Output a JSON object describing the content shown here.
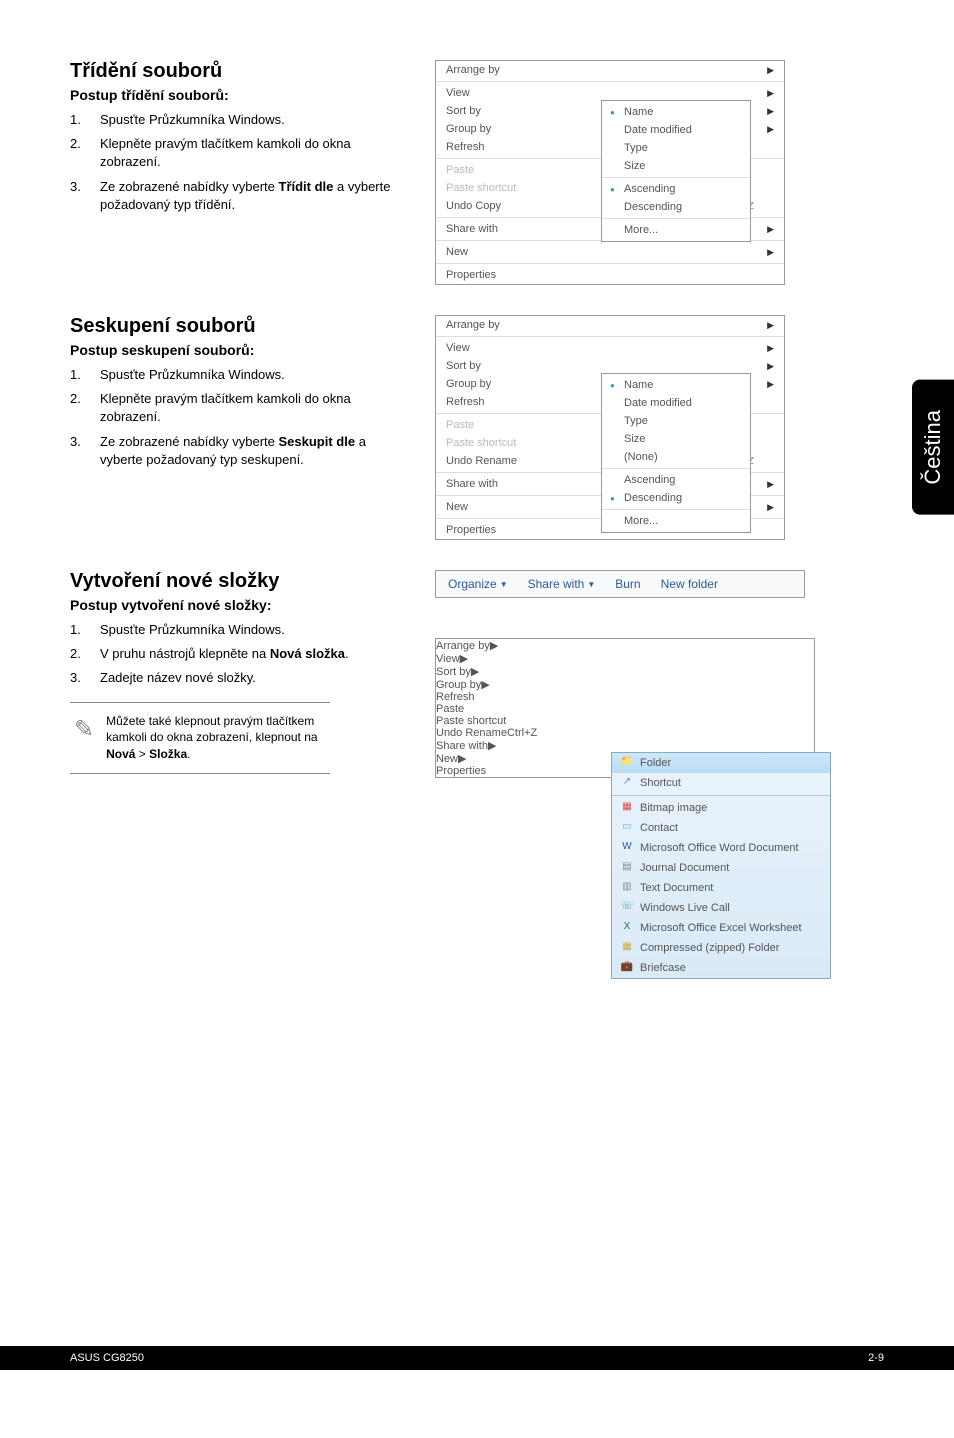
{
  "side_tab": "Čeština",
  "sec1": {
    "title": "Třídění souborů",
    "sub": "Postup třídění souborů:",
    "steps": [
      "Spusťte Průzkumníka Windows.",
      "Klepněte pravým tlačítkem kamkoli do okna zobrazení.",
      "Ze zobrazené nabídky vyberte <b>Třídit dle</b> a vyberte požadovaný typ třídění."
    ]
  },
  "sec2": {
    "title": "Seskupení souborů",
    "sub": "Postup seskupení souborů:",
    "steps": [
      "Spusťte Průzkumníka Windows.",
      "Klepněte pravým tlačítkem kamkoli do okna zobrazení.",
      "Ze zobrazené nabídky vyberte <b>Seskupit dle</b> a vyberte požadovaný typ seskupení."
    ]
  },
  "sec3": {
    "title": "Vytvoření nové složky",
    "sub": "Postup vytvoření nové složky:",
    "steps": [
      "Spusťte Průzkumníka Windows.",
      "V pruhu nástrojů klepněte na <b>Nová složka</b>.",
      "Zadejte název nové složky."
    ],
    "note": "Můžete také klepnout pravým tlačítkem kamkoli do okna zobrazení, klepnout na <b>Nová</b> > <b>Složka</b>."
  },
  "ctx_common": {
    "arrange": "Arrange by",
    "view": "View",
    "sortby": "Sort by",
    "groupby": "Group by",
    "refresh": "Refresh",
    "paste": "Paste",
    "pastesc": "Paste shortcut",
    "undocopy": "Undo Copy",
    "undorename": "Undo Rename",
    "ctrlz": "Ctrl+Z",
    "sharewith": "Share with",
    "new": "New",
    "properties": "Properties"
  },
  "sub_common": {
    "name": "Name",
    "datemod": "Date modified",
    "type": "Type",
    "size": "Size",
    "none": "(None)",
    "asc": "Ascending",
    "desc": "Descending",
    "more": "More..."
  },
  "toolbar": {
    "organize": "Organize",
    "sharewith": "Share with",
    "burn": "Burn",
    "newfolder": "New folder"
  },
  "new_menu": {
    "folder": "Folder",
    "shortcut": "Shortcut",
    "bitmap": "Bitmap image",
    "contact": "Contact",
    "word": "Microsoft Office Word Document",
    "journal": "Journal Document",
    "text": "Text Document",
    "livecall": "Windows Live Call",
    "excel": "Microsoft Office Excel Worksheet",
    "zip": "Compressed (zipped) Folder",
    "briefcase": "Briefcase"
  },
  "footer": {
    "model": "ASUS CG8250",
    "page": "2-9"
  }
}
